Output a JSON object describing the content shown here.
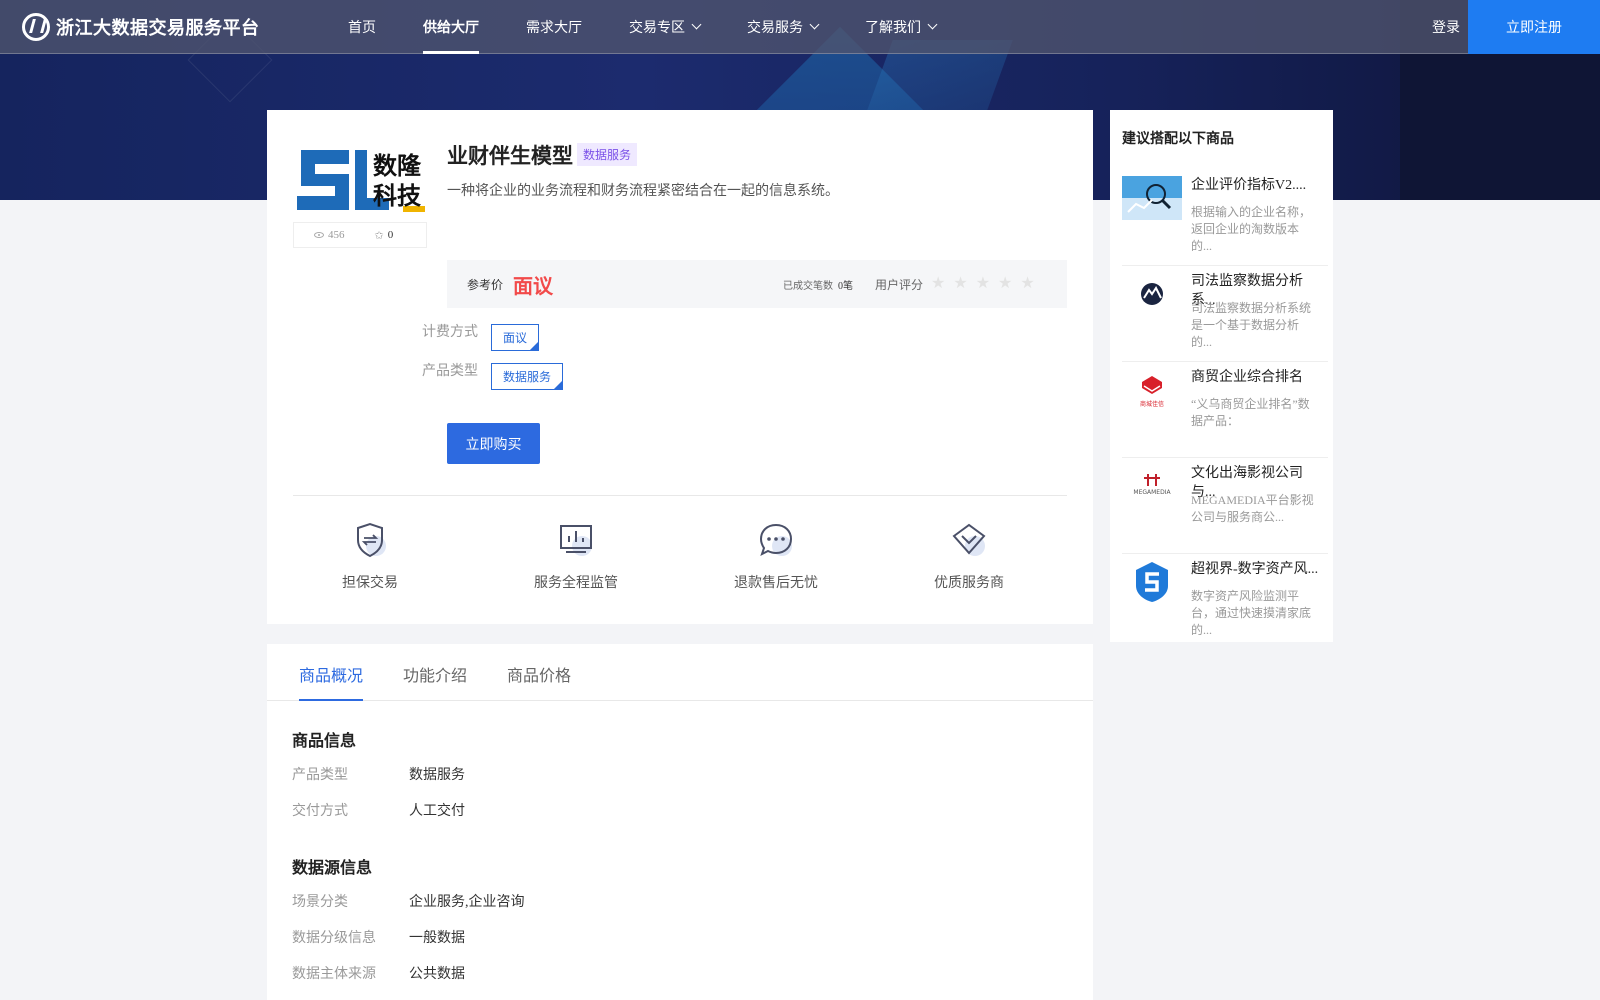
{
  "header": {
    "logo_text": "浙江大数据交易服务平台",
    "nav": [
      {
        "label": "首页"
      },
      {
        "label": "供给大厅"
      },
      {
        "label": "需求大厅"
      },
      {
        "label": "交易专区"
      },
      {
        "label": "交易服务"
      },
      {
        "label": "了解我们"
      }
    ],
    "login": "登录",
    "register": "立即注册"
  },
  "product": {
    "logo_text_1": "数隆",
    "logo_text_2": "科技",
    "views": "456",
    "favorites": "0",
    "title": "业财伴生模型",
    "tag": "数据服务",
    "description": "一种将企业的业务流程和财务流程紧密结合在一起的信息系统。",
    "price_label": "参考价",
    "price_value": "面议",
    "deals_label": "已成交笔数",
    "deals_value": "0笔",
    "rating_label": "用户评分",
    "rating_stars": "★★★★★",
    "billing_label": "计费方式",
    "billing_value": "面议",
    "type_label": "产品类型",
    "type_value": "数据服务",
    "buy_label": "立即购买"
  },
  "features": [
    {
      "label": "担保交易"
    },
    {
      "label": "服务全程监管"
    },
    {
      "label": "退款售后无忧"
    },
    {
      "label": "优质服务商"
    }
  ],
  "tabs": [
    {
      "label": "商品概况"
    },
    {
      "label": "功能介绍"
    },
    {
      "label": "商品价格"
    }
  ],
  "info": {
    "section1_title": "商品信息",
    "rows1": [
      {
        "label": "产品类型",
        "value": "数据服务"
      },
      {
        "label": "交付方式",
        "value": "人工交付"
      }
    ],
    "section2_title": "数据源信息",
    "rows2": [
      {
        "label": "场景分类",
        "value": "企业服务,企业咨询"
      },
      {
        "label": "数据分级信息",
        "value": "一般数据"
      },
      {
        "label": "数据主体来源",
        "value": "公共数据"
      }
    ]
  },
  "sidebar": {
    "title": "建议搭配以下商品",
    "items": [
      {
        "name": "企业评价指标V2....",
        "desc": "根据输入的企业名称，返回企业的淘数版本的..."
      },
      {
        "name": "司法监察数据分析系...",
        "desc": "司法监察数据分析系统是一个基于数据分析的..."
      },
      {
        "name": "商贸企业综合排名",
        "desc": "“义乌商贸企业排名”数据产品：",
        "img_text": "商城佳信"
      },
      {
        "name": "文化出海影视公司与...",
        "desc": "MEGAMEDIA平台影视公司与服务商公...",
        "img_text": "MEGAMEDIA"
      },
      {
        "name": "超视界-数字资产风...",
        "desc": "数字资产风险监测平台，通过快速摸清家底的..."
      }
    ]
  },
  "colors": {
    "primary": "#2d6ae0",
    "price": "#f24a4a",
    "tag_bg": "#efe9ff",
    "tag_text": "#7b51e8"
  }
}
